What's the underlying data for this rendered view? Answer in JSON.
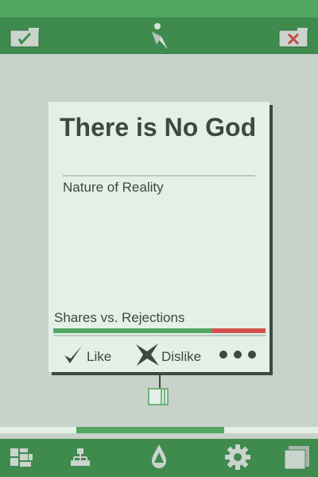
{
  "card": {
    "title": "There is No God",
    "subtitle": "Nature of Reality",
    "metric": {
      "label": "Shares vs. Rejections",
      "shares_fraction": 0.75,
      "share_color": "#52a660",
      "rejection_color": "#d75050"
    },
    "actions": {
      "like": "Like",
      "dislike": "Dislike"
    }
  },
  "progress": {
    "start_fraction": 0.24,
    "end_fraction": 0.705
  },
  "colors": {
    "toolbar": "#3f8a4d",
    "statusbar": "#52a660",
    "background": "#c9d1cb",
    "card": "#e3f0e8",
    "ink": "#3e4741"
  },
  "icons": {
    "toolbar": [
      "accept-box-icon",
      "compass-logo-icon",
      "reject-box-icon"
    ],
    "card": [
      "checkmark-icon",
      "cross-icon",
      "more-dots-icon",
      "node-box-icon"
    ],
    "bottombar": [
      "grid-icon",
      "tree-icon",
      "home-drop-icon",
      "gear-icon",
      "layers-icon"
    ]
  }
}
